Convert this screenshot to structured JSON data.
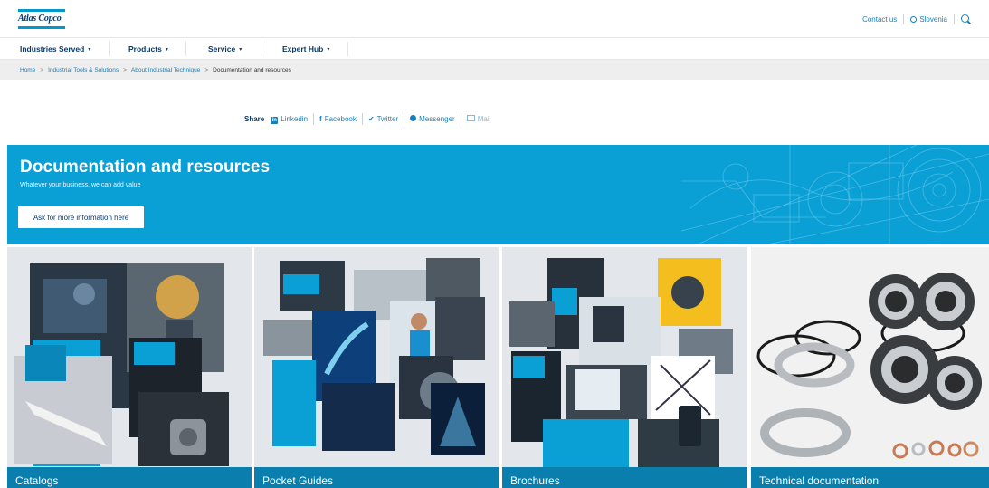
{
  "header": {
    "logo_text": "Atlas Copco",
    "contact": "Contact us",
    "region": "Slovenia"
  },
  "nav": {
    "items": [
      {
        "label": "Industries Served"
      },
      {
        "label": "Products"
      },
      {
        "label": "Service"
      },
      {
        "label": "Expert Hub"
      }
    ],
    "caret": "▾"
  },
  "breadcrumb": {
    "items": [
      "Home",
      "Industrial Tools & Solutions",
      "About Industrial Technique"
    ],
    "current": "Documentation and resources",
    "separator": ">"
  },
  "share": {
    "label": "Share",
    "linkedin": "Linkedin",
    "facebook": "Facebook",
    "twitter": "Twitter",
    "messenger": "Messenger",
    "mail": "Mail"
  },
  "hero": {
    "title": "Documentation and resources",
    "subtitle": "Whatever your business, we can add value",
    "cta": "Ask for more information here"
  },
  "tiles": [
    {
      "caption": "Catalogs"
    },
    {
      "caption": "Pocket Guides"
    },
    {
      "caption": "Brochures"
    },
    {
      "caption": "Technical documentation"
    }
  ],
  "colors": {
    "brand_blue": "#0aa0d6",
    "caption_blue": "#0a7fae",
    "navy": "#0a3a6a",
    "link_blue": "#1a7fb8"
  },
  "icons": [
    "globe-icon",
    "search-icon",
    "linkedin-icon",
    "facebook-icon",
    "twitter-icon",
    "messenger-icon",
    "mail-icon"
  ]
}
